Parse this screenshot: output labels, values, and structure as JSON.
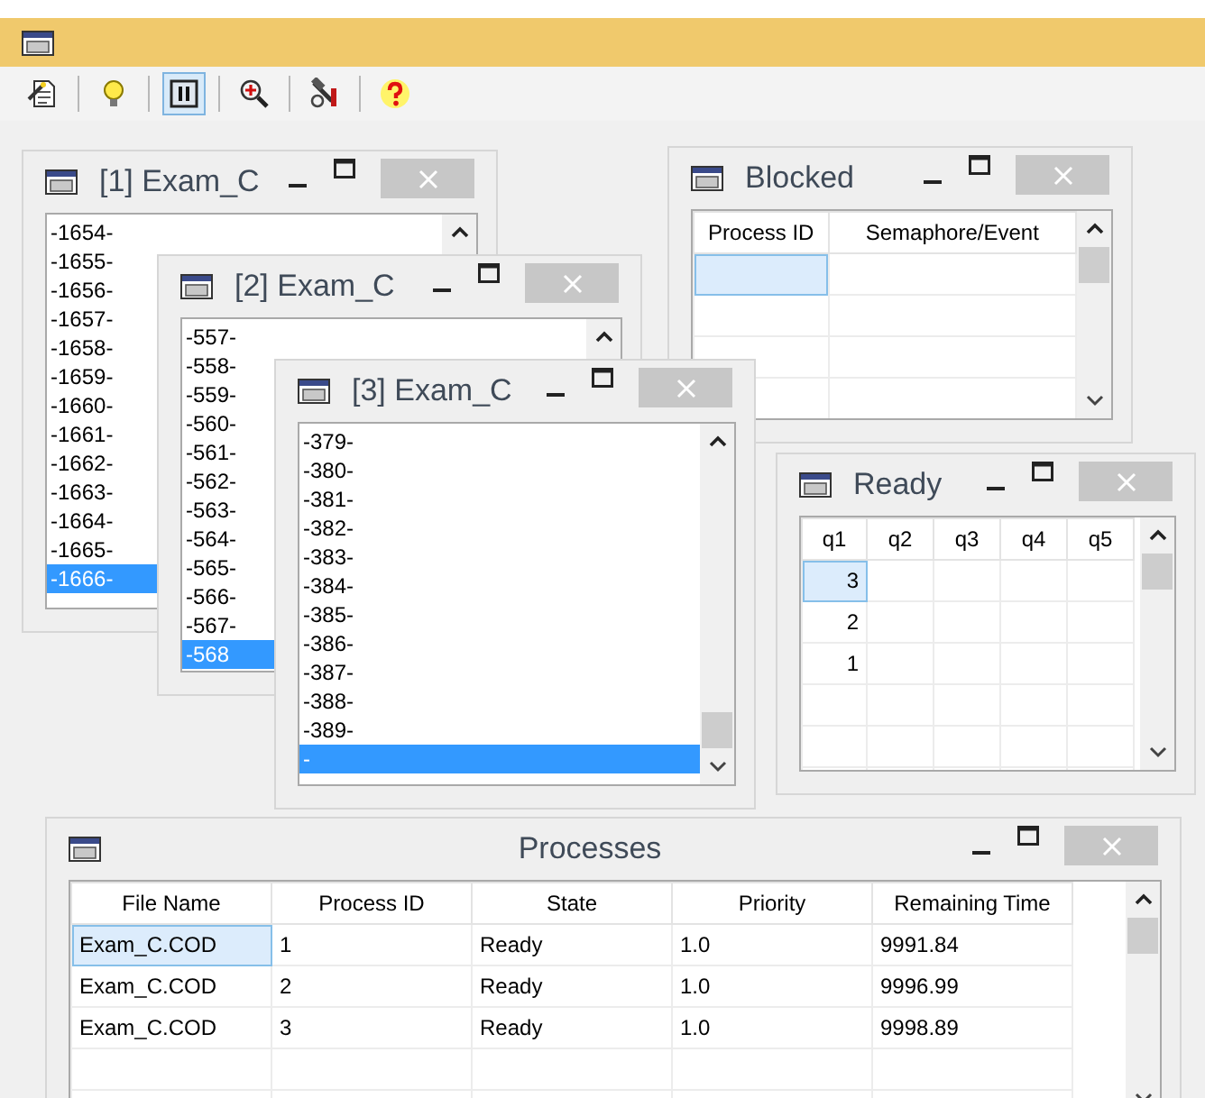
{
  "toolbar": [
    {
      "kind": "document",
      "selected": false
    },
    {
      "kind": "bulb",
      "selected": false
    },
    {
      "kind": "pause",
      "selected": true
    },
    {
      "kind": "zoom",
      "selected": false
    },
    {
      "kind": "tools",
      "selected": false
    },
    {
      "kind": "help",
      "selected": false
    }
  ],
  "windows": [
    {
      "kind": "list",
      "title": "[1] Exam_C",
      "items": [
        {
          "text": "-1654-",
          "selected": false
        },
        {
          "text": "-1655-",
          "selected": false
        },
        {
          "text": "-1656-",
          "selected": false
        },
        {
          "text": "-1657-",
          "selected": false
        },
        {
          "text": "-1658-",
          "selected": false
        },
        {
          "text": "-1659-",
          "selected": false
        },
        {
          "text": "-1660-",
          "selected": false
        },
        {
          "text": "-1661-",
          "selected": false
        },
        {
          "text": "-1662-",
          "selected": false
        },
        {
          "text": "-1663-",
          "selected": false
        },
        {
          "text": "-1664-",
          "selected": false
        },
        {
          "text": "-1665-",
          "selected": false
        },
        {
          "text": "-1666-",
          "selected": true
        }
      ]
    },
    {
      "kind": "grid",
      "title": "Blocked",
      "columns": [
        "Process ID",
        "Semaphore/Event"
      ],
      "blank_row_focused": true
    },
    {
      "kind": "list",
      "title": "[2] Exam_C",
      "items": [
        {
          "text": "-557-",
          "selected": false
        },
        {
          "text": "-558-",
          "selected": false
        },
        {
          "text": "-559-",
          "selected": false
        },
        {
          "text": "-560-",
          "selected": false
        },
        {
          "text": "-561-",
          "selected": false
        },
        {
          "text": "-562-",
          "selected": false
        },
        {
          "text": "-563-",
          "selected": false
        },
        {
          "text": "-564-",
          "selected": false
        },
        {
          "text": "-565-",
          "selected": false
        },
        {
          "text": "-566-",
          "selected": false
        },
        {
          "text": "-567-",
          "selected": false
        },
        {
          "text": "-568",
          "selected": true
        }
      ]
    },
    {
      "kind": "list",
      "title": "[3] Exam_C",
      "items": [
        {
          "text": "-379-",
          "selected": false
        },
        {
          "text": "-380-",
          "selected": false
        },
        {
          "text": "-381-",
          "selected": false
        },
        {
          "text": "-382-",
          "selected": false
        },
        {
          "text": "-383-",
          "selected": false
        },
        {
          "text": "-384-",
          "selected": false
        },
        {
          "text": "-385-",
          "selected": false
        },
        {
          "text": "-386-",
          "selected": false
        },
        {
          "text": "-387-",
          "selected": false
        },
        {
          "text": "-388-",
          "selected": false
        },
        {
          "text": "-389-",
          "selected": false
        },
        {
          "text": "-",
          "selected": true
        }
      ]
    },
    {
      "kind": "grid",
      "title": "Ready",
      "columns": [
        "q1",
        "q2",
        "q3",
        "q4",
        "q5"
      ],
      "rows": [
        {
          "cells": [
            "3"
          ],
          "focused": true
        },
        {
          "cells": [
            "2"
          ],
          "focused": false
        },
        {
          "cells": [
            "1"
          ],
          "focused": false
        }
      ]
    },
    {
      "kind": "grid",
      "title": "Processes",
      "columns": [
        "File Name",
        "Process ID",
        "State",
        "Priority",
        "Remaining Time"
      ],
      "rows": [
        {
          "cells": [
            "Exam_C.COD",
            "1",
            "Ready",
            "1.0",
            "9991.84"
          ],
          "focused": true
        },
        {
          "cells": [
            "Exam_C.COD",
            "2",
            "Ready",
            "1.0",
            "9996.99"
          ],
          "focused": false
        },
        {
          "cells": [
            "Exam_C.COD",
            "3",
            "Ready",
            "1.0",
            "9998.89"
          ],
          "focused": false
        }
      ]
    }
  ]
}
